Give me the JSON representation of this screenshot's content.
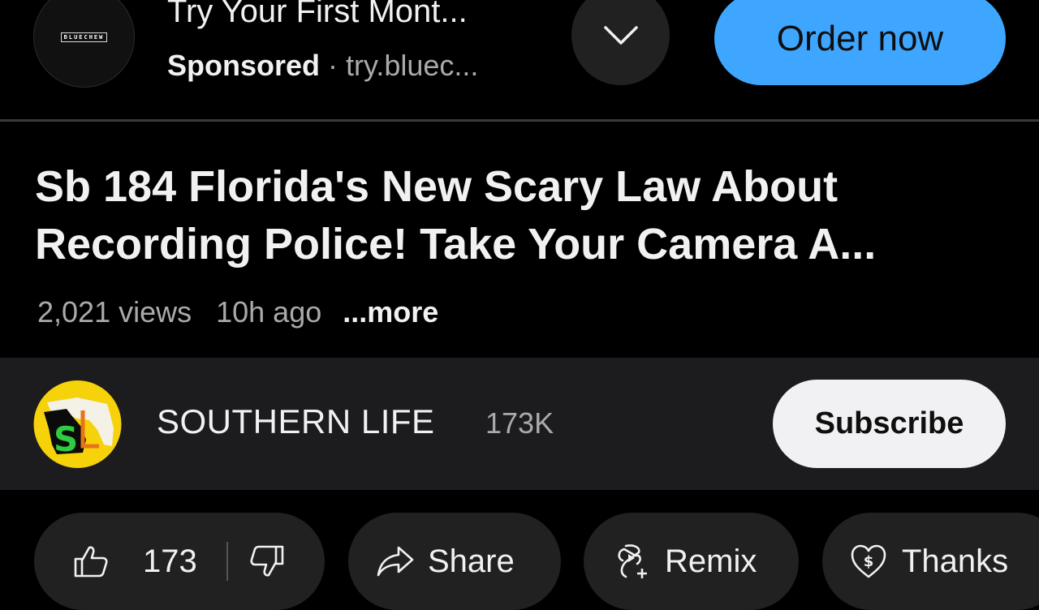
{
  "ad": {
    "logo_text": "BLUECHEW",
    "title": "Try Your First Mont...",
    "sponsored_label": "Sponsored",
    "separator": "·",
    "url": "try.bluec...",
    "expand_icon": "chevron-down-icon",
    "cta_label": "Order now",
    "cta_color": "#3ea6ff"
  },
  "video": {
    "title": "Sb 184 Florida's New Scary Law About Recording Police! Take Your Camera A...",
    "views": "2,021 views",
    "age": "10h ago",
    "more_label": "...more"
  },
  "channel": {
    "name": "SOUTHERN LIFE",
    "subscribers": "173K",
    "avatar_letters": "SL",
    "subscribe_label": "Subscribe"
  },
  "actions": {
    "like_count": "173",
    "like_icon": "thumbs-up-icon",
    "dislike_icon": "thumbs-down-icon",
    "share_label": "Share",
    "share_icon": "share-arrow-icon",
    "remix_label": "Remix",
    "remix_icon": "remix-icon",
    "thanks_label": "Thanks",
    "thanks_icon": "heart-dollar-icon"
  }
}
